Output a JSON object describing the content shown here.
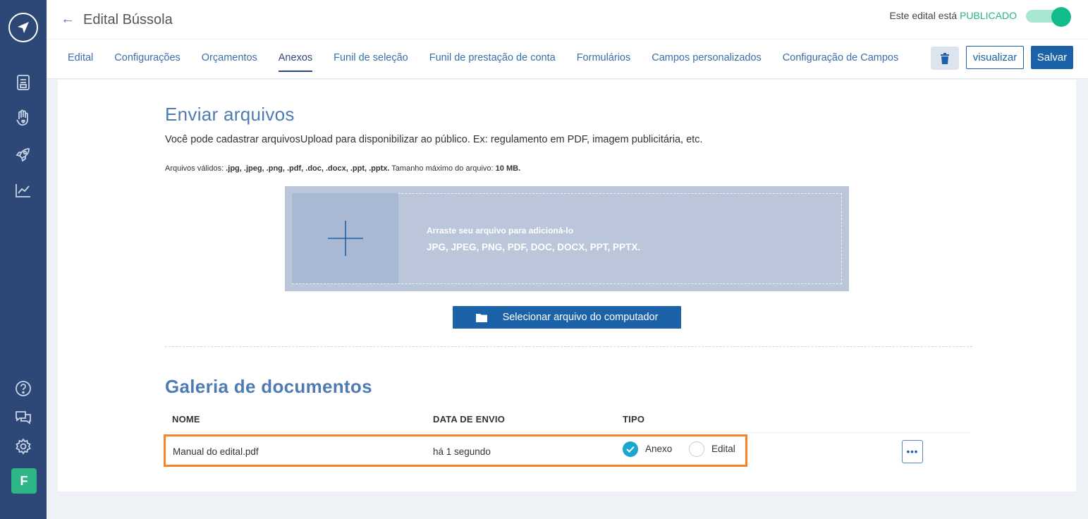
{
  "header": {
    "title": "Edital Bússola",
    "status_prefix": "Este edital está",
    "status_value": "PUBLICADO"
  },
  "tabs": [
    {
      "label": "Edital"
    },
    {
      "label": "Configurações"
    },
    {
      "label": "Orçamentos"
    },
    {
      "label": "Anexos",
      "active": true
    },
    {
      "label": "Funil de seleção"
    },
    {
      "label": "Funil de prestação de conta"
    },
    {
      "label": "Formulários"
    },
    {
      "label": "Campos personalizados"
    },
    {
      "label": "Configuração de Campos"
    }
  ],
  "toolbar": {
    "view_label": "visualizar",
    "save_label": "Salvar"
  },
  "sidebar": {
    "avatar_letter": "F"
  },
  "upload": {
    "title": "Enviar arquivos",
    "description": "Você pode cadastrar arquivosUpload para disponibilizar ao público. Ex: regulamento em PDF, imagem publicitária, etc.",
    "formats_prefix": "Arquivos válidos: ",
    "formats_list": ".jpg, .jpeg, .png, .pdf, .doc, .docx, .ppt, .pptx.",
    "max_prefix": " Tamanho máximo do arquivo: ",
    "max_size": "10 MB.",
    "drop_hint": "Arraste seu arquivo para adicioná-lo",
    "drop_types": "JPG, JPEG, PNG, PDF, DOC, DOCX, PPT, PPTX.",
    "select_button": "Selecionar arquivo do computador"
  },
  "gallery": {
    "title": "Galeria de documentos",
    "columns": [
      "NOME",
      "DATA DE ENVIO",
      "TIPO"
    ],
    "rows": [
      {
        "name": "Manual do edital.pdf",
        "date": "há 1 segundo",
        "type_options": [
          "Anexo",
          "Edital"
        ],
        "selected": "Anexo"
      }
    ]
  },
  "colors": {
    "sidebar": "#2d4877",
    "accent": "#1c62a8",
    "published": "#26b38c",
    "highlight": "#f5832a"
  }
}
